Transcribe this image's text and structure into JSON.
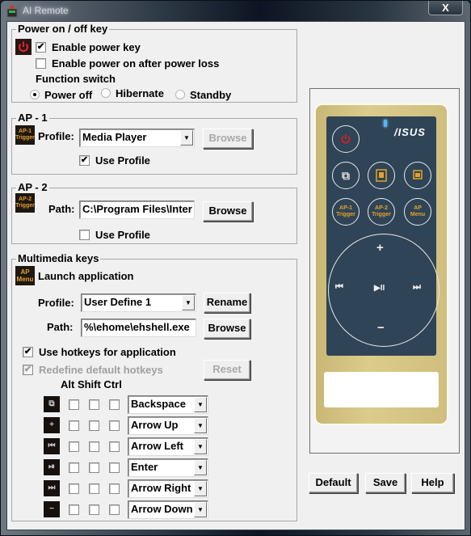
{
  "window": {
    "title": "AI Remote",
    "close_label": "X"
  },
  "power": {
    "group_label": "Power on / off key",
    "enable_power_key": {
      "label": "Enable power key",
      "checked": true
    },
    "enable_power_on_after_loss": {
      "label": "Enable power on after power loss",
      "checked": false
    },
    "function_switch_label": "Function switch",
    "function_options": [
      {
        "label": "Power off",
        "selected": true
      },
      {
        "label": "Hibernate",
        "selected": false
      },
      {
        "label": "Standby",
        "selected": false
      }
    ]
  },
  "ap1": {
    "group_label": "AP - 1",
    "icon_text": [
      "AP-1",
      "Trigger"
    ],
    "profile_label": "Profile:",
    "profile_value": "Media Player",
    "browse_label": "Browse",
    "browse_enabled": false,
    "use_profile": {
      "label": "Use Profile",
      "checked": true
    }
  },
  "ap2": {
    "group_label": "AP - 2",
    "icon_text": [
      "AP-2",
      "Trigger"
    ],
    "path_label": "Path:",
    "path_value": "C:\\Program Files\\Inter",
    "browse_label": "Browse",
    "use_profile": {
      "label": "Use Profile",
      "checked": false
    }
  },
  "multimedia": {
    "group_label": "Multimedia keys",
    "icon_text": [
      "AP",
      "Menu"
    ],
    "launch_label": "Launch application",
    "profile_label": "Profile:",
    "profile_value": "User Define 1",
    "rename_label": "Rename",
    "path_label": "Path:",
    "path_value": "%\\ehome\\ehshell.exe",
    "browse_label": "Browse",
    "use_hotkeys": {
      "label": "Use hotkeys for application",
      "checked": true
    },
    "redefine_hotkeys": {
      "label": "Redefine default hotkeys",
      "checked": true,
      "enabled": false
    },
    "reset_label": "Reset",
    "modifier_header": "Alt Shift Ctrl",
    "hotkeys": [
      {
        "icon": "window-switch-icon",
        "glyph": "⧉",
        "alt": false,
        "shift": false,
        "ctrl": false,
        "key": "Backspace"
      },
      {
        "icon": "plus-icon",
        "glyph": "+",
        "alt": false,
        "shift": false,
        "ctrl": false,
        "key": "Arrow Up"
      },
      {
        "icon": "previous-track-icon",
        "glyph": "⏮",
        "alt": false,
        "shift": false,
        "ctrl": false,
        "key": "Arrow Left"
      },
      {
        "icon": "play-pause-icon",
        "glyph": "⏯",
        "alt": false,
        "shift": false,
        "ctrl": false,
        "key": "Enter"
      },
      {
        "icon": "next-track-icon",
        "glyph": "⏭",
        "alt": false,
        "shift": false,
        "ctrl": false,
        "key": "Arrow Right"
      },
      {
        "icon": "minus-icon",
        "glyph": "−",
        "alt": false,
        "shift": false,
        "ctrl": false,
        "key": "Arrow Down"
      }
    ]
  },
  "remote": {
    "brand": "/ISUS",
    "buttons": {
      "ap1": [
        "AP-1",
        "Trigger"
      ],
      "ap2": [
        "AP-2",
        "Trigger"
      ],
      "apmenu": [
        "AP",
        "Menu"
      ],
      "plus": "+",
      "minus": "−",
      "prev": "⏮",
      "play": "▶II",
      "next": "⏭"
    }
  },
  "footer": {
    "default_label": "Default",
    "save_label": "Save",
    "help_label": "Help"
  },
  "colors": {
    "remote_body": "#2f4456",
    "remote_trim": "#d6c583",
    "accent_orange": "#e4a328",
    "power_red": "#c8202a",
    "led_blue": "#4fb6ff"
  }
}
